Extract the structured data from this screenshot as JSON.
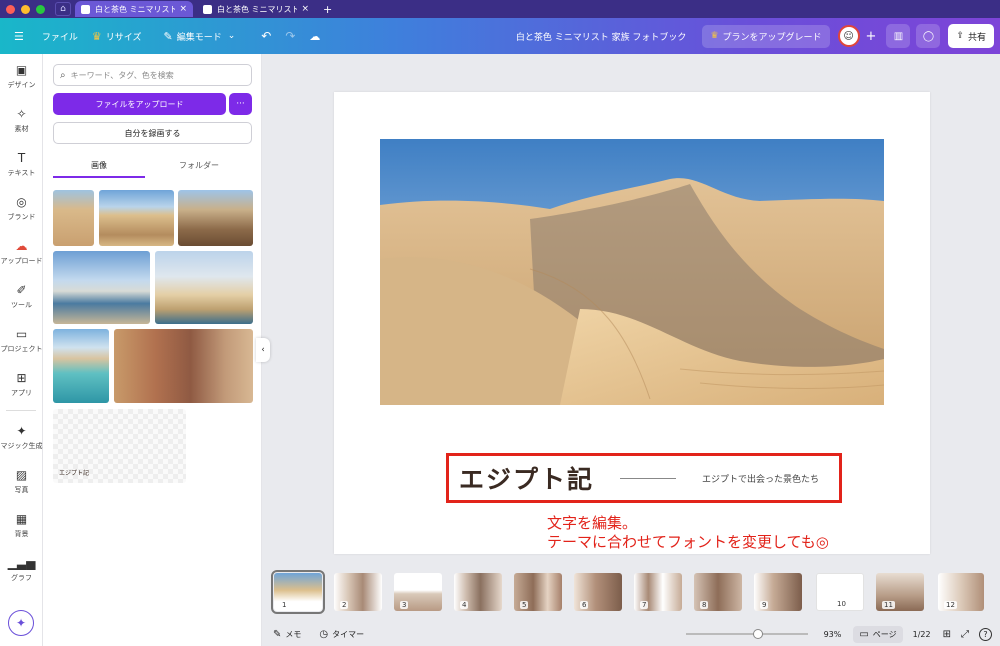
{
  "chrome": {
    "tabs": [
      {
        "title": "白と茶色 ミニマリスト...",
        "active": true
      },
      {
        "title": "白と茶色 ミニマリスト...",
        "active": false
      }
    ]
  },
  "topbar": {
    "file": "ファイル",
    "resize": "リサイズ",
    "edit_mode": "編集モード",
    "doc_title": "白と茶色 ミニマリスト 家族 フォトブック",
    "upgrade": "プランをアップグレード",
    "share": "共有"
  },
  "rail": [
    {
      "label": "デザイン",
      "icon": "design-icon"
    },
    {
      "label": "素材",
      "icon": "elements-icon"
    },
    {
      "label": "テキスト",
      "icon": "text-icon"
    },
    {
      "label": "ブランド",
      "icon": "brand-icon"
    },
    {
      "label": "アップロード",
      "icon": "upload-icon"
    },
    {
      "label": "ツール",
      "icon": "tools-icon"
    },
    {
      "label": "プロジェクト",
      "icon": "folder-icon"
    },
    {
      "label": "アプリ",
      "icon": "apps-icon"
    },
    {
      "label": "マジック生成",
      "icon": "magic-media-icon"
    },
    {
      "label": "写真",
      "icon": "photo-icon"
    },
    {
      "label": "背景",
      "icon": "background-icon"
    },
    {
      "label": "グラフ",
      "icon": "chart-icon"
    }
  ],
  "panel": {
    "search_placeholder": "キーワード、タグ、色を検索",
    "upload_button": "ファイルをアップロード",
    "more_button": "···",
    "record_button": "自分を録画する",
    "tabs": [
      "画像",
      "フォルダー"
    ],
    "thumb_caption": "エジプト記"
  },
  "canvas": {
    "title": "エジプト記",
    "subtitle": "エジプトで出会った景色たち",
    "annotation_line1": "文字を編集。",
    "annotation_line2": "テーマに合わせてフォントを変更しても◎"
  },
  "pages": [
    "1",
    "2",
    "3",
    "4",
    "5",
    "6",
    "7",
    "8",
    "9",
    "10",
    "11",
    "12"
  ],
  "bottom": {
    "notes": "メモ",
    "timer": "タイマー",
    "zoom_percent": 93,
    "zoom_label": "93%",
    "pages_label": "ページ",
    "page_counter": "1/22",
    "help": "?"
  },
  "colors": {
    "accent": "#7d2ae8",
    "annotation": "#e2231a",
    "title_text": "#3a2a22"
  }
}
